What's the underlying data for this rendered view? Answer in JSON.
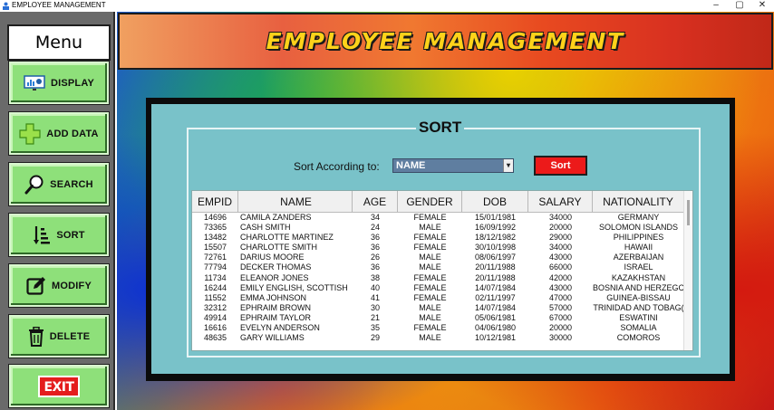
{
  "window": {
    "title": "EMPLOYEE MANAGEMENT",
    "minimize": "–",
    "maximize": "▢",
    "close": "✕"
  },
  "sidebar": {
    "menu_title": "Menu",
    "items": [
      {
        "label": "DISPLAY",
        "icon": "display-chart-icon"
      },
      {
        "label": "ADD DATA",
        "icon": "plus-icon"
      },
      {
        "label": "SEARCH",
        "icon": "magnifier-icon"
      },
      {
        "label": "SORT",
        "icon": "sort-icon"
      },
      {
        "label": "MODIFY",
        "icon": "edit-icon"
      },
      {
        "label": "DELETE",
        "icon": "trash-icon"
      }
    ],
    "exit_label": "EXIT"
  },
  "header": {
    "title": "EMPLOYEE MANAGEMENT"
  },
  "sort_panel": {
    "title": "SORT",
    "sort_label": "Sort According to:",
    "selected": "NAME",
    "button": "Sort"
  },
  "table": {
    "columns": [
      "EMPID",
      "NAME",
      "AGE",
      "GENDER",
      "DOB",
      "SALARY",
      "NATIONALITY"
    ],
    "rows": [
      [
        "14696",
        "CAMILA ZANDERS",
        "34",
        "FEMALE",
        "15/01/1981",
        "34000",
        "GERMANY"
      ],
      [
        "73365",
        "CASH SMITH",
        "24",
        "MALE",
        "16/09/1992",
        "20000",
        "SOLOMON ISLANDS"
      ],
      [
        "13482",
        "CHARLOTTE MARTINEZ",
        "36",
        "FEMALE",
        "18/12/1982",
        "29000",
        "PHILIPPINES"
      ],
      [
        "15507",
        "CHARLOTTE SMITH",
        "36",
        "FEMALE",
        "30/10/1998",
        "34000",
        "HAWAII"
      ],
      [
        "72761",
        "DARIUS MOORE",
        "26",
        "MALE",
        "08/06/1997",
        "43000",
        "AZERBAIJAN"
      ],
      [
        "77794",
        "DECKER THOMAS",
        "36",
        "MALE",
        "20/11/1988",
        "66000",
        "ISRAEL"
      ],
      [
        "11734",
        "ELEANOR JONES",
        "38",
        "FEMALE",
        "20/11/1988",
        "42000",
        "KAZAKHSTAN"
      ],
      [
        "16244",
        "EMILY ENGLISH, SCOTTISH",
        "40",
        "FEMALE",
        "14/07/1984",
        "43000",
        "BOSNIA AND HERZEGC"
      ],
      [
        "11552",
        "EMMA JOHNSON",
        "41",
        "FEMALE",
        "02/11/1997",
        "47000",
        "GUINEA-BISSAU"
      ],
      [
        "32312",
        "EPHRAIM BROWN",
        "30",
        "MALE",
        "14/07/1984",
        "57000",
        "TRINIDAD AND TOBAG("
      ],
      [
        "49914",
        "EPHRAIM TAYLOR",
        "21",
        "MALE",
        "05/06/1981",
        "67000",
        "ESWATINI"
      ],
      [
        "16616",
        "EVELYN ANDERSON",
        "35",
        "FEMALE",
        "04/06/1980",
        "20000",
        "SOMALIA"
      ],
      [
        "48635",
        "GARY WILLIAMS",
        "29",
        "MALE",
        "10/12/1981",
        "30000",
        "COMOROS"
      ]
    ]
  }
}
